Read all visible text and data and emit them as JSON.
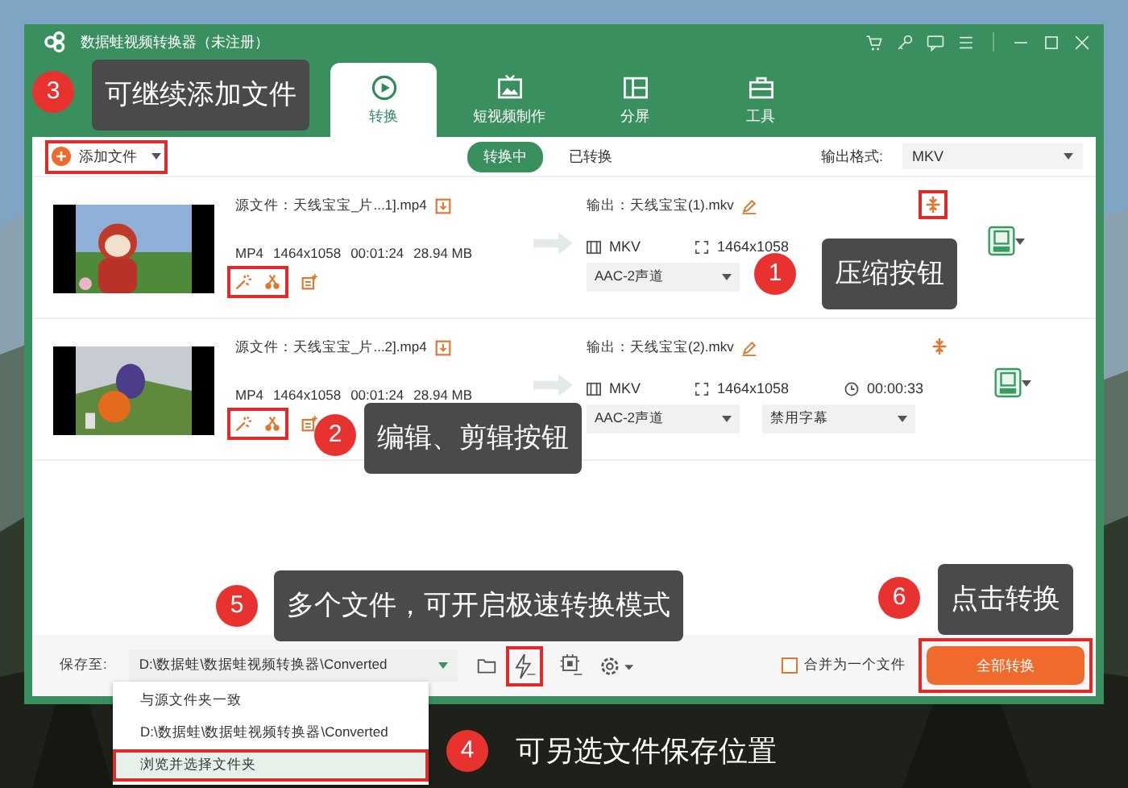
{
  "window": {
    "title": "数据蛙视频转换器（未注册）"
  },
  "tabs": [
    {
      "label": "转换",
      "selected": true
    },
    {
      "label": "短视频制作",
      "selected": false
    },
    {
      "label": "分屏",
      "selected": false
    },
    {
      "label": "工具",
      "selected": false
    }
  ],
  "toolbar": {
    "add_button": "添加文件",
    "segments": [
      {
        "label": "转换中",
        "selected": true
      },
      {
        "label": "已转换",
        "selected": false
      }
    ],
    "format_label": "输出格式:",
    "format_value": "MKV"
  },
  "files": [
    {
      "source": "源文件：天线宝宝_片...1].mp4",
      "format": "MP4",
      "resolution": "1464x1058",
      "duration": "00:01:24",
      "size": "28.94 MB",
      "output": "输出：天线宝宝(1).mkv",
      "out_format": "MKV",
      "out_resolution": "1464x1058",
      "audio": "AAC-2声道"
    },
    {
      "source": "源文件：天线宝宝_片...2].mp4",
      "format": "MP4",
      "resolution": "1464x1058",
      "duration": "00:01:24",
      "size": "28.94 MB",
      "output": "输出：天线宝宝(2).mkv",
      "out_format": "MKV",
      "out_resolution": "1464x1058",
      "out_duration": "00:00:33",
      "audio": "AAC-2声道",
      "subtitle": "禁用字幕"
    }
  ],
  "bottom_bar": {
    "save_label": "保存至:",
    "save_path": "D:\\数据蛙\\数据蛙视频转换器\\Converted",
    "merge_label": "合并为一个文件",
    "merge_checked": false,
    "convert_button": "全部转换"
  },
  "save_menu": [
    {
      "label": "与源文件夹一致",
      "highlighted": false
    },
    {
      "label": "D:\\数据蛙\\数据蛙视频转换器\\Converted",
      "highlighted": false
    },
    {
      "label": "浏览并选择文件夹",
      "highlighted": true
    }
  ],
  "annotations": [
    {
      "number": "1",
      "text": "压缩按钮",
      "kind": "box"
    },
    {
      "number": "2",
      "text": "编辑、剪辑按钮",
      "kind": "box"
    },
    {
      "number": "3",
      "text": "可继续添加文件",
      "kind": "box"
    },
    {
      "number": "4",
      "text": "可另选文件保存位置",
      "kind": "plain"
    },
    {
      "number": "5",
      "text": "多个文件，可开启极速转换模式",
      "kind": "box"
    },
    {
      "number": "6",
      "text": "点击转换",
      "kind": "box"
    }
  ]
}
